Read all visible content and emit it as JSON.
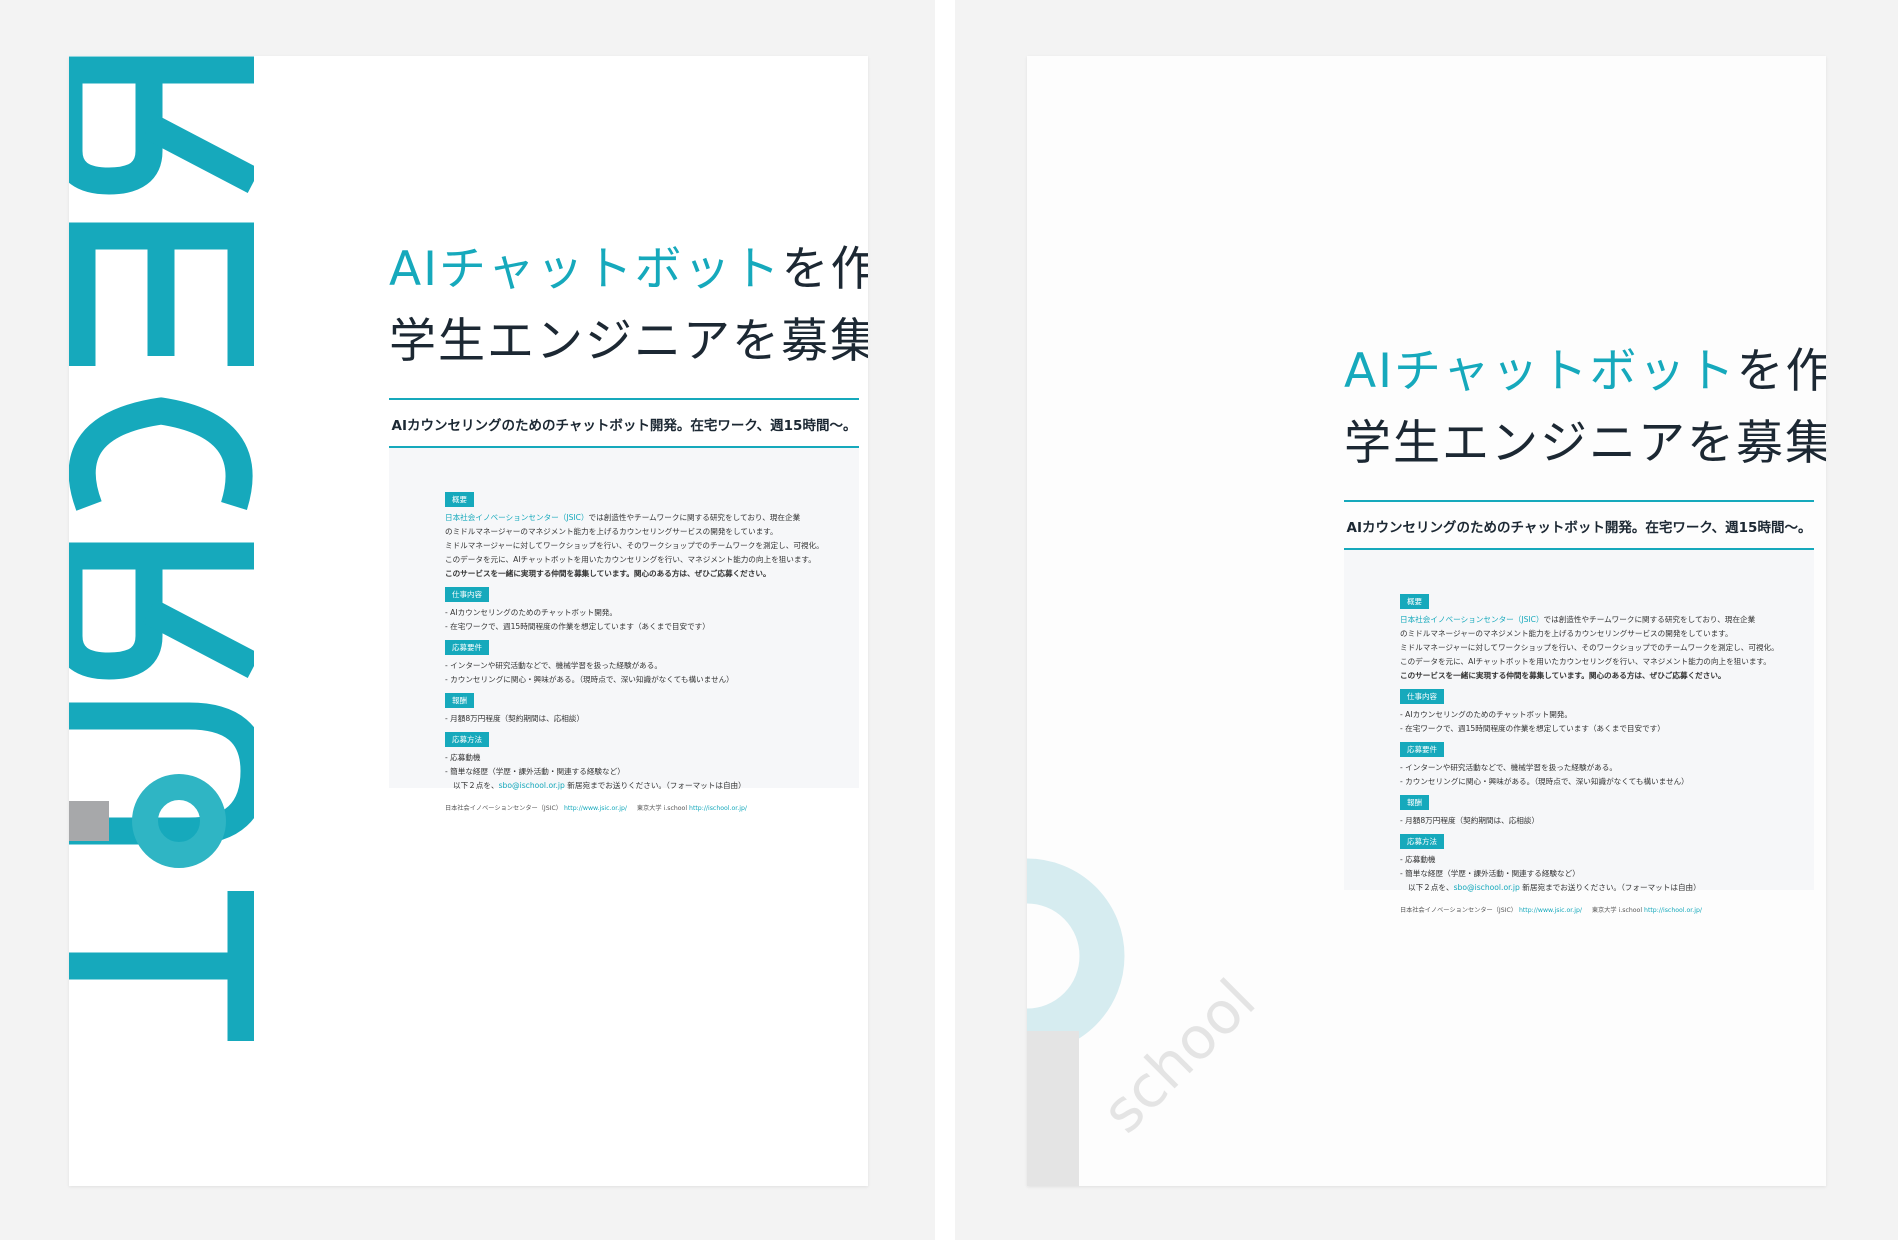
{
  "recruit_text": "RECRUIT",
  "title_line1_accent": "AIチャットボット",
  "title_line1_rest": "を作る",
  "title_line2": "学生エンジニアを募集。",
  "subtitle": "AIカウンセリングのためのチャットボット開発。在宅ワーク、週15時間〜。",
  "overview": {
    "tag": "概要",
    "line1_link": "日本社会イノベーションセンター（JSIC）",
    "line1_rest": "では創造性やチームワークに関する研究をしており、現在企業",
    "line2": "のミドルマネージャーのマネジメント能力を上げるカウンセリングサービスの開発をしています。",
    "line3": "ミドルマネージャーに対してワークショップを行い、そのワークショップでのチームワークを測定し、可視化。",
    "line4": "このデータを元に、AIチャットボットを用いたカウンセリングを行い、マネジメント能力の向上を狙います。",
    "line5": "このサービスを一緒に実現する仲間を募集しています。関心のある方は、ぜひご応募ください。"
  },
  "job": {
    "tag": "仕事内容",
    "line1": "- AIカウンセリングのためのチャットボット開発。",
    "line2": "- 在宅ワークで、週15時間程度の作業を想定しています（あくまで目安です）"
  },
  "requirements": {
    "tag": "応募要件",
    "line1": "- インターンや研究活動などで、機械学習を扱った経験がある。",
    "line2": "- カウンセリングに関心・興味がある。（現時点で、深い知識がなくても構いません）"
  },
  "pay": {
    "tag": "報酬",
    "line1": "- 月額8万円程度（契約期間は、応相談）"
  },
  "apply": {
    "tag": "応募方法",
    "line1": "- 応募動機",
    "line2": "- 簡単な経歴（学歴・課外活動・関連する経験など）",
    "line3_pre": "以下２点を、",
    "line3_link": "sbo@ischool.or.jp",
    "line3_post": " 新居宛までお送りください。（フォーマットは自由）"
  },
  "footer": {
    "org1": "日本社会イノベーションセンター（JSIC）",
    "url1": "http://www.jsic.or.jp/",
    "org2": "東京大学 i.school",
    "url2": "http://ischool.or.jp/"
  },
  "school_mark_text": "school",
  "colors": {
    "accent": "#16a9bc",
    "recruit_light": "#2fb5c4",
    "gray": "#a7a8aa",
    "text": "#1c2833",
    "mark_circle": "#d6ecf0",
    "mark_bar": "#e4e4e4"
  }
}
